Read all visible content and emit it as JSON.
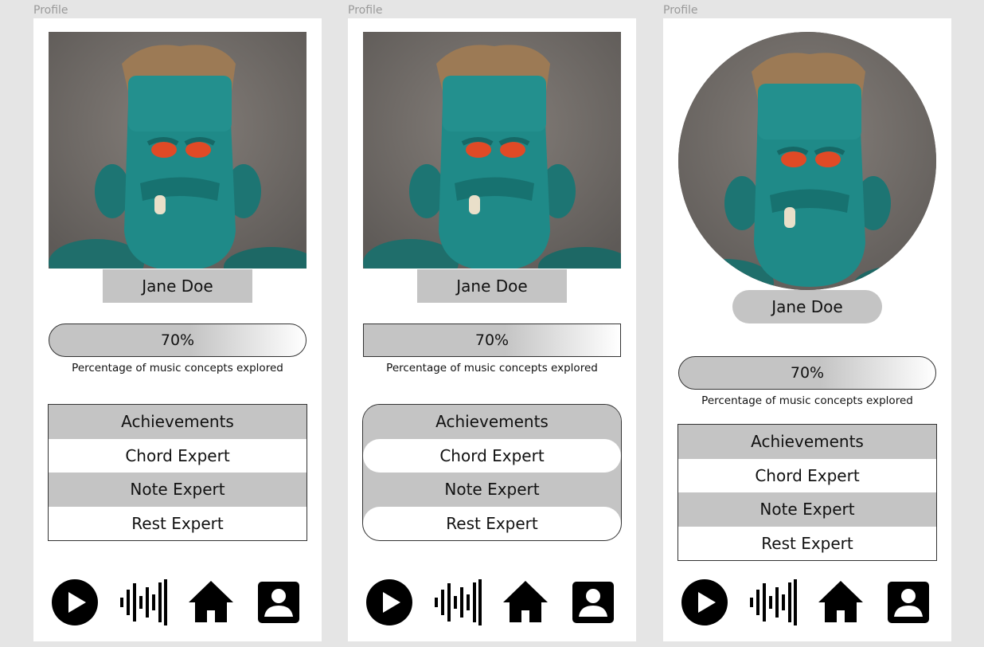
{
  "frames": [
    {
      "label": "Profile",
      "user_name": "Jane Doe",
      "progress_value": "70%",
      "progress_caption": "Percentage of music concepts explored",
      "achievements_header": "Achievements",
      "achievements": [
        "Chord Expert",
        "Note Expert",
        "Rest Expert"
      ]
    },
    {
      "label": "Profile",
      "user_name": "Jane Doe",
      "progress_value": "70%",
      "progress_caption": "Percentage of music concepts explored",
      "achievements_header": "Achievements",
      "achievements": [
        "Chord Expert",
        "Note Expert",
        "Rest Expert"
      ]
    },
    {
      "label": "Profile",
      "user_name": "Jane Doe",
      "progress_value": "70%",
      "progress_caption": "Percentage of music concepts explored",
      "achievements_header": "Achievements",
      "achievements": [
        "Chord Expert",
        "Note Expert",
        "Rest Expert"
      ]
    }
  ],
  "progress_fraction": 0.7,
  "nav_icons": [
    "play-icon",
    "audio-waveform-icon",
    "home-icon",
    "profile-icon"
  ],
  "colors": {
    "background": "#e5e5e5",
    "panel": "#ffffff",
    "fill": "#c4c4c4",
    "icon": "#000000"
  }
}
